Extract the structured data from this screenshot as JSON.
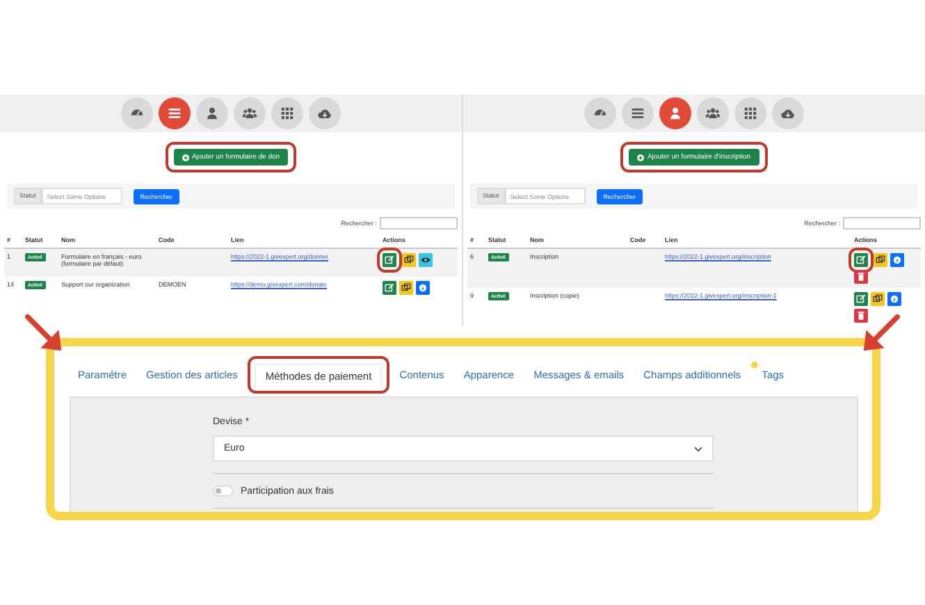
{
  "panels": [
    {
      "nav": [
        {
          "kind": "gauge",
          "selected": false
        },
        {
          "kind": "list",
          "selected": true
        },
        {
          "kind": "user",
          "selected": false
        },
        {
          "kind": "users",
          "selected": false
        },
        {
          "kind": "grid",
          "selected": false
        },
        {
          "kind": "cloud",
          "selected": false
        }
      ],
      "add_button": {
        "label": "Ajouter un formulaire de don",
        "highlighted": true
      },
      "filter": {
        "label": "Statut",
        "placeholder": "Select Some Options",
        "button": "Rechercher"
      },
      "search_label": "Rechercher :",
      "columns": [
        "#",
        "Statut",
        "Nom",
        "Code",
        "Lien",
        "Actions"
      ],
      "rows": [
        {
          "number": "1",
          "status": "Activé",
          "name": "Formulaire en français - euro (formulaire par défaut)",
          "code": "",
          "link": "https://2022-1.givexpert.org/donner",
          "actions": [
            {
              "kind": "edit",
              "highlighted": true
            },
            {
              "kind": "copy",
              "highlighted": false
            },
            {
              "kind": "view",
              "highlighted": false
            }
          ]
        },
        {
          "number": "14",
          "status": "Activé",
          "name": "Support our organization",
          "code": "DEMOEN",
          "link": "https://demo.givexpert.com/donate",
          "actions": [
            {
              "kind": "edit",
              "highlighted": false
            },
            {
              "kind": "copy",
              "highlighted": false
            },
            {
              "kind": "info",
              "highlighted": false
            }
          ]
        }
      ]
    },
    {
      "nav": [
        {
          "kind": "gauge",
          "selected": false
        },
        {
          "kind": "list",
          "selected": false
        },
        {
          "kind": "user",
          "selected": true
        },
        {
          "kind": "users",
          "selected": false
        },
        {
          "kind": "grid",
          "selected": false
        },
        {
          "kind": "cloud",
          "selected": false
        }
      ],
      "add_button": {
        "label": "Ajouter un formulaire d'inscription",
        "highlighted": true
      },
      "filter": {
        "label": "Statut",
        "placeholder": "Select Some Options",
        "button": "Rechercher"
      },
      "search_label": "Rechercher :",
      "columns": [
        "#",
        "Statut",
        "Nom",
        "Code",
        "Lien",
        "Actions"
      ],
      "rows": [
        {
          "number": "6",
          "status": "Activé",
          "name": "Inscription",
          "code": "",
          "link": "https://2022-1.givexpert.org/inscription",
          "actions": [
            {
              "kind": "edit",
              "highlighted": true
            },
            {
              "kind": "copy",
              "highlighted": false
            },
            {
              "kind": "info",
              "highlighted": false
            },
            {
              "kind": "delete",
              "highlighted": false
            }
          ]
        },
        {
          "number": "9",
          "status": "Activé",
          "name": "Inscription (copie)",
          "code": "",
          "link": "https://2022-1.givexpert.org/inscription-1",
          "actions": [
            {
              "kind": "edit",
              "highlighted": false
            },
            {
              "kind": "copy",
              "highlighted": false
            },
            {
              "kind": "info",
              "highlighted": false
            },
            {
              "kind": "delete",
              "highlighted": false
            }
          ]
        }
      ]
    }
  ],
  "editor": {
    "tabs": [
      {
        "label": "Paramétre",
        "selected": false,
        "highlighted": false
      },
      {
        "label": "Gestion des articles",
        "selected": false,
        "highlighted": false
      },
      {
        "label": "Méthodes de paiement",
        "selected": true,
        "highlighted": true
      },
      {
        "label": "Contenus",
        "selected": false,
        "highlighted": false
      },
      {
        "label": "Apparence",
        "selected": false,
        "highlighted": false
      },
      {
        "label": "Messages & emails",
        "selected": false,
        "highlighted": false
      },
      {
        "label": "Champs additionnels",
        "selected": false,
        "highlighted": false
      },
      {
        "label": "Tags",
        "selected": false,
        "highlighted": false
      }
    ],
    "currency_label": "Devise *",
    "currency_value": "Euro",
    "fee_toggle": {
      "label": "Participation aux frais",
      "on": false
    }
  }
}
